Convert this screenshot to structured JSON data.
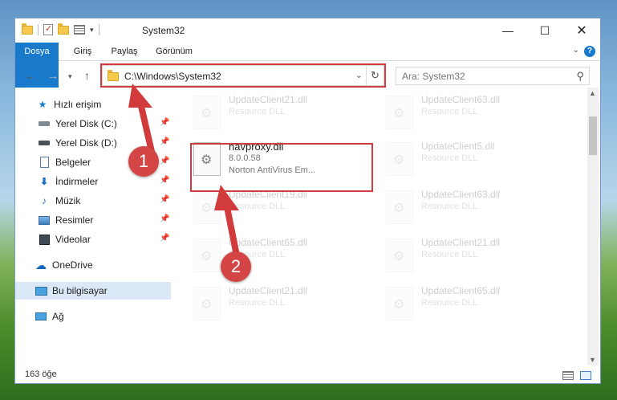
{
  "window": {
    "title": "System32",
    "controls": {
      "minimize": "—",
      "maximize": "☐",
      "close": "✕"
    }
  },
  "ribbon": {
    "tabs": [
      "Dosya",
      "Giriş",
      "Paylaş",
      "Görünüm"
    ],
    "help": "?"
  },
  "address": {
    "path": "C:\\Windows\\System32",
    "search_placeholder": "Ara: System32"
  },
  "sidebar": {
    "quick_access": "Hızlı erişim",
    "items": [
      {
        "label": "Yerel Disk (C:)",
        "icon": "drive-icon",
        "pinned": true
      },
      {
        "label": "Yerel Disk (D:)",
        "icon": "drive-icon",
        "pinned": true
      },
      {
        "label": "Belgeler",
        "icon": "document-icon",
        "pinned": true
      },
      {
        "label": "İndirmeler",
        "icon": "download-icon",
        "pinned": true
      },
      {
        "label": "Müzik",
        "icon": "music-icon",
        "pinned": true
      },
      {
        "label": "Resimler",
        "icon": "picture-icon",
        "pinned": true
      },
      {
        "label": "Videolar",
        "icon": "video-icon",
        "pinned": true
      }
    ],
    "onedrive": "OneDrive",
    "this_pc": "Bu bilgisayar",
    "network": "Ağ"
  },
  "files": {
    "main": {
      "name": "navproxy.dll",
      "version": "8.0.0.58",
      "description": "Norton AntiVirus Em..."
    },
    "faded": [
      {
        "name": "UpdateClient21.dll",
        "type": "Resource DLL"
      },
      {
        "name": "UpdateClient63.dll",
        "type": "Resource DLL"
      },
      {
        "name": "UpdateClient5.dll",
        "type": "Resource DLL"
      },
      {
        "name": "UpdateClient19.dll",
        "type": "Resource DLL"
      },
      {
        "name": "UpdateClient63.dll",
        "type": "Resource DLL"
      },
      {
        "name": "UpdateClient65.dll",
        "type": "Resource DLL"
      },
      {
        "name": "UpdateClient21.dll",
        "type": "Resource DLL"
      },
      {
        "name": "UpdateClient21.dll",
        "type": "Resource DLL"
      },
      {
        "name": "UpdateClient65.dll",
        "type": "Resource DLL"
      }
    ]
  },
  "status": {
    "count": "163 öğe"
  },
  "annotations": {
    "step1": "1",
    "step2": "2",
    "color": "#d23b3b"
  },
  "colors": {
    "accent": "#1979ca",
    "selected": "#dbe8f7"
  }
}
